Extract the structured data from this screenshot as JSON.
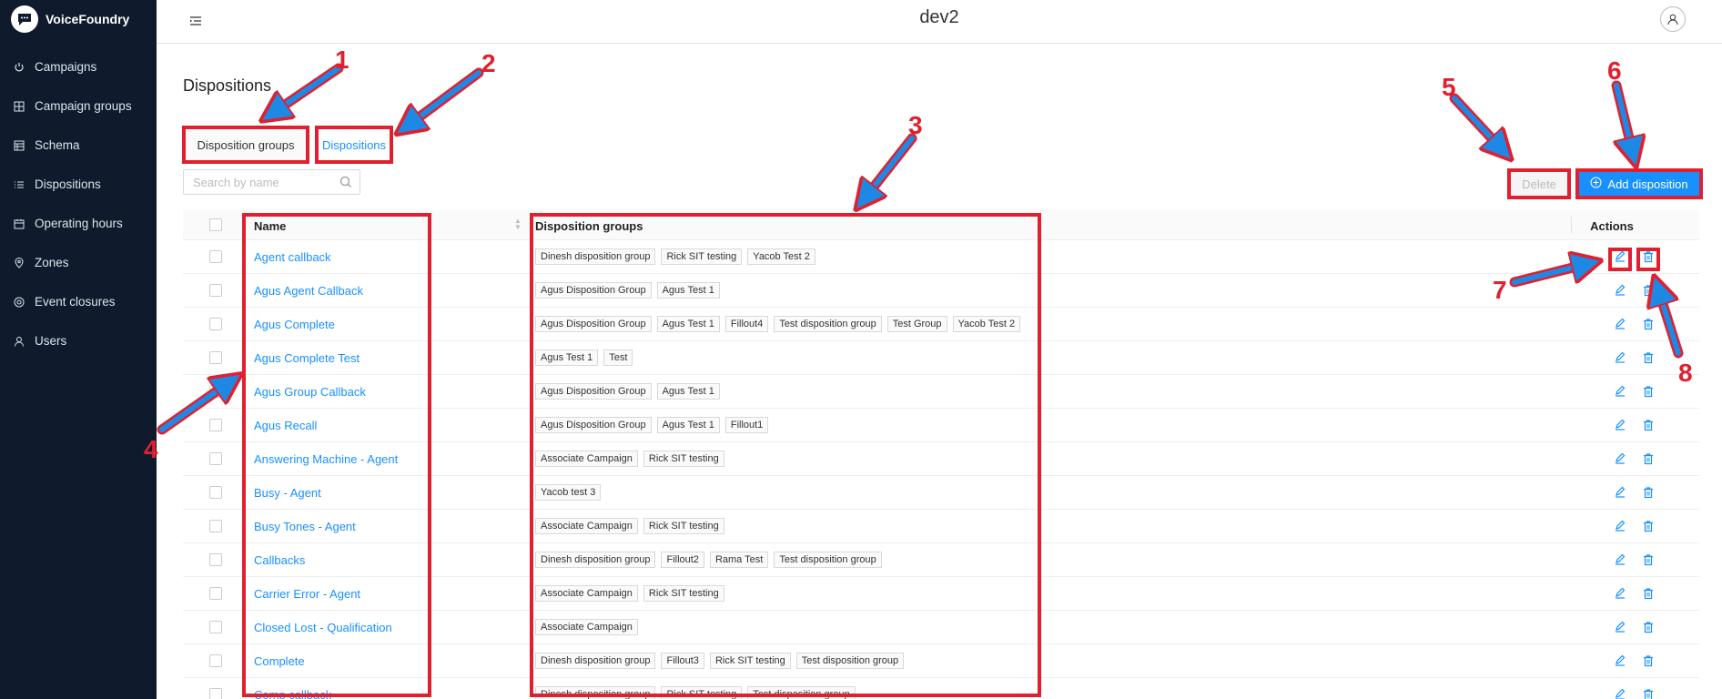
{
  "brand": {
    "name": "VoiceFoundry",
    "logo_icon": "chat-bubble-icon"
  },
  "sidebar": {
    "items": [
      {
        "label": "Campaigns",
        "icon": "power-icon"
      },
      {
        "label": "Campaign groups",
        "icon": "grid-icon"
      },
      {
        "label": "Schema",
        "icon": "table-icon"
      },
      {
        "label": "Dispositions",
        "icon": "list-icon"
      },
      {
        "label": "Operating hours",
        "icon": "calendar-icon"
      },
      {
        "label": "Zones",
        "icon": "pin-icon"
      },
      {
        "label": "Event closures",
        "icon": "target-icon"
      },
      {
        "label": "Users",
        "icon": "user-icon"
      }
    ]
  },
  "header": {
    "env": "dev2"
  },
  "page": {
    "title": "Dispositions"
  },
  "tabs": {
    "groups": "Disposition groups",
    "dispositions": "Dispositions"
  },
  "search": {
    "placeholder": "Search by name"
  },
  "toolbar": {
    "delete_label": "Delete",
    "add_label": "Add disposition"
  },
  "table": {
    "headers": {
      "name": "Name",
      "groups": "Disposition groups",
      "actions": "Actions"
    },
    "rows": [
      {
        "name": "Agent callback",
        "groups": [
          "Dinesh disposition group",
          "Rick SIT testing",
          "Yacob Test 2"
        ]
      },
      {
        "name": "Agus Agent Callback",
        "groups": [
          "Agus Disposition Group",
          "Agus Test 1"
        ]
      },
      {
        "name": "Agus Complete",
        "groups": [
          "Agus Disposition Group",
          "Agus Test 1",
          "Fillout4",
          "Test disposition group",
          "Test Group",
          "Yacob Test 2"
        ]
      },
      {
        "name": "Agus Complete Test",
        "groups": [
          "Agus Test 1",
          "Test"
        ]
      },
      {
        "name": "Agus Group Callback",
        "groups": [
          "Agus Disposition Group",
          "Agus Test 1"
        ]
      },
      {
        "name": "Agus Recall",
        "groups": [
          "Agus Disposition Group",
          "Agus Test 1",
          "Fillout1"
        ]
      },
      {
        "name": "Answering Machine - Agent",
        "groups": [
          "Associate Campaign",
          "Rick SIT testing"
        ]
      },
      {
        "name": "Busy - Agent",
        "groups": [
          "Yacob test 3"
        ]
      },
      {
        "name": "Busy Tones - Agent",
        "groups": [
          "Associate Campaign",
          "Rick SIT testing"
        ]
      },
      {
        "name": "Callbacks",
        "groups": [
          "Dinesh disposition group",
          "Fillout2",
          "Rama Test",
          "Test disposition group"
        ]
      },
      {
        "name": "Carrier Error - Agent",
        "groups": [
          "Associate Campaign",
          "Rick SIT testing"
        ]
      },
      {
        "name": "Closed Lost - Qualification",
        "groups": [
          "Associate Campaign"
        ]
      },
      {
        "name": "Complete",
        "groups": [
          "Dinesh disposition group",
          "Fillout3",
          "Rick SIT testing",
          "Test disposition group"
        ]
      },
      {
        "name": "Comp callback",
        "groups": [
          "Dinesh disposition group",
          "Rick SIT testing",
          "Test disposition group"
        ]
      }
    ]
  },
  "annotations": {
    "color": "#e0202e",
    "arrow_fill": "#1e88e5",
    "labels": [
      "1",
      "2",
      "3",
      "4",
      "5",
      "6",
      "7",
      "8"
    ]
  }
}
